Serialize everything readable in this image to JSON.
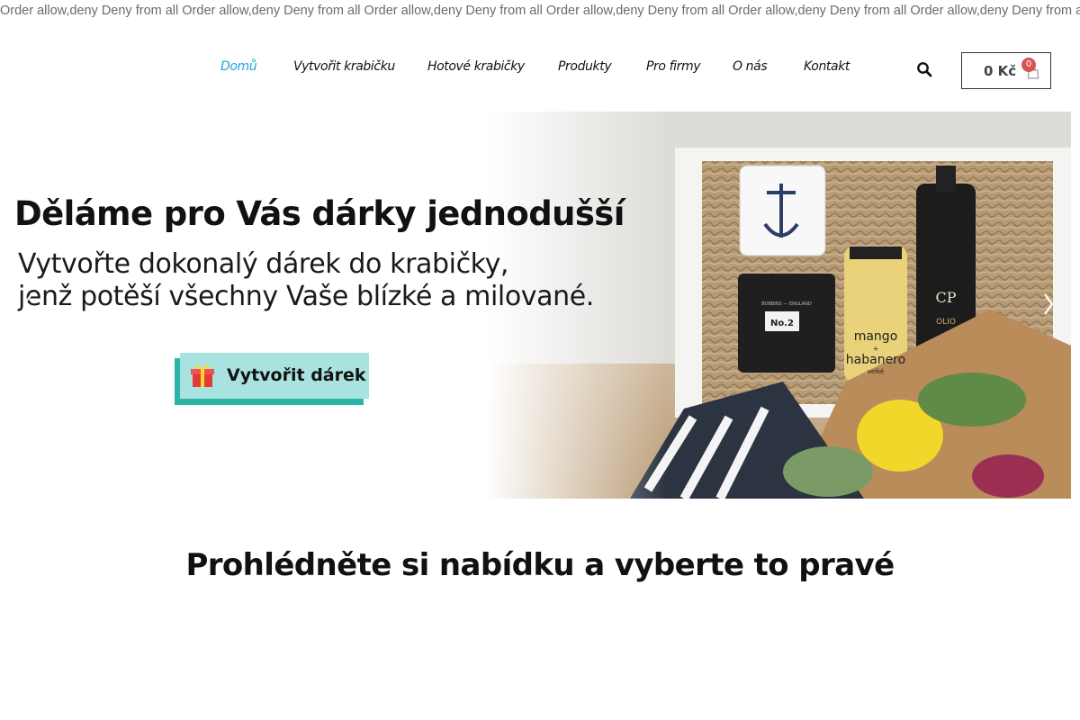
{
  "error_text": "Order allow,deny Deny from all Order allow,deny Deny from all Order allow,deny Deny from all Order allow,deny Deny from all Order allow,deny Deny from all Order allow,deny Deny from all Order allow,deny Deny from all",
  "nav": {
    "items": [
      {
        "label": "Domů",
        "active": true
      },
      {
        "label": "Vytvořit krabičku",
        "active": false
      },
      {
        "label": "Hotové krabičky",
        "active": false
      },
      {
        "label": "Produkty",
        "active": false
      },
      {
        "label": "Pro firmy",
        "active": false
      },
      {
        "label": "O nás",
        "active": false
      },
      {
        "label": "Kontakt",
        "active": false
      }
    ],
    "active_color": "#1aa8d8"
  },
  "search": {
    "icon": "search-icon"
  },
  "cart": {
    "amount": "0 Kč",
    "count": "0",
    "icon": "shopping-bag-icon"
  },
  "hero": {
    "title": "Děláme pro Vás dárky jednodušší",
    "subtitle_line1": "Vytvořte dokonalý dárek do krabičky,",
    "subtitle_line2": "jenž potěší všechny Vaše blízké a milované.",
    "cta_label": "Vytvořit dárek",
    "cta_icon": "gift-icon",
    "cta_color": "#a9e3df",
    "cta_shadow_color": "#2bb5a7",
    "product_labels": {
      "candle": "No.2",
      "candle_brand": "BOBBINS — ENGLAND",
      "sauce_line1": "mango",
      "sauce_line2": "+",
      "sauce_line3": "habanero",
      "sauce_line4": "velké",
      "bottle": "CP",
      "bottle_brand": "OLIO"
    }
  },
  "section": {
    "heading": "Prohlédněte si nabídku a vyberte to pravé"
  }
}
